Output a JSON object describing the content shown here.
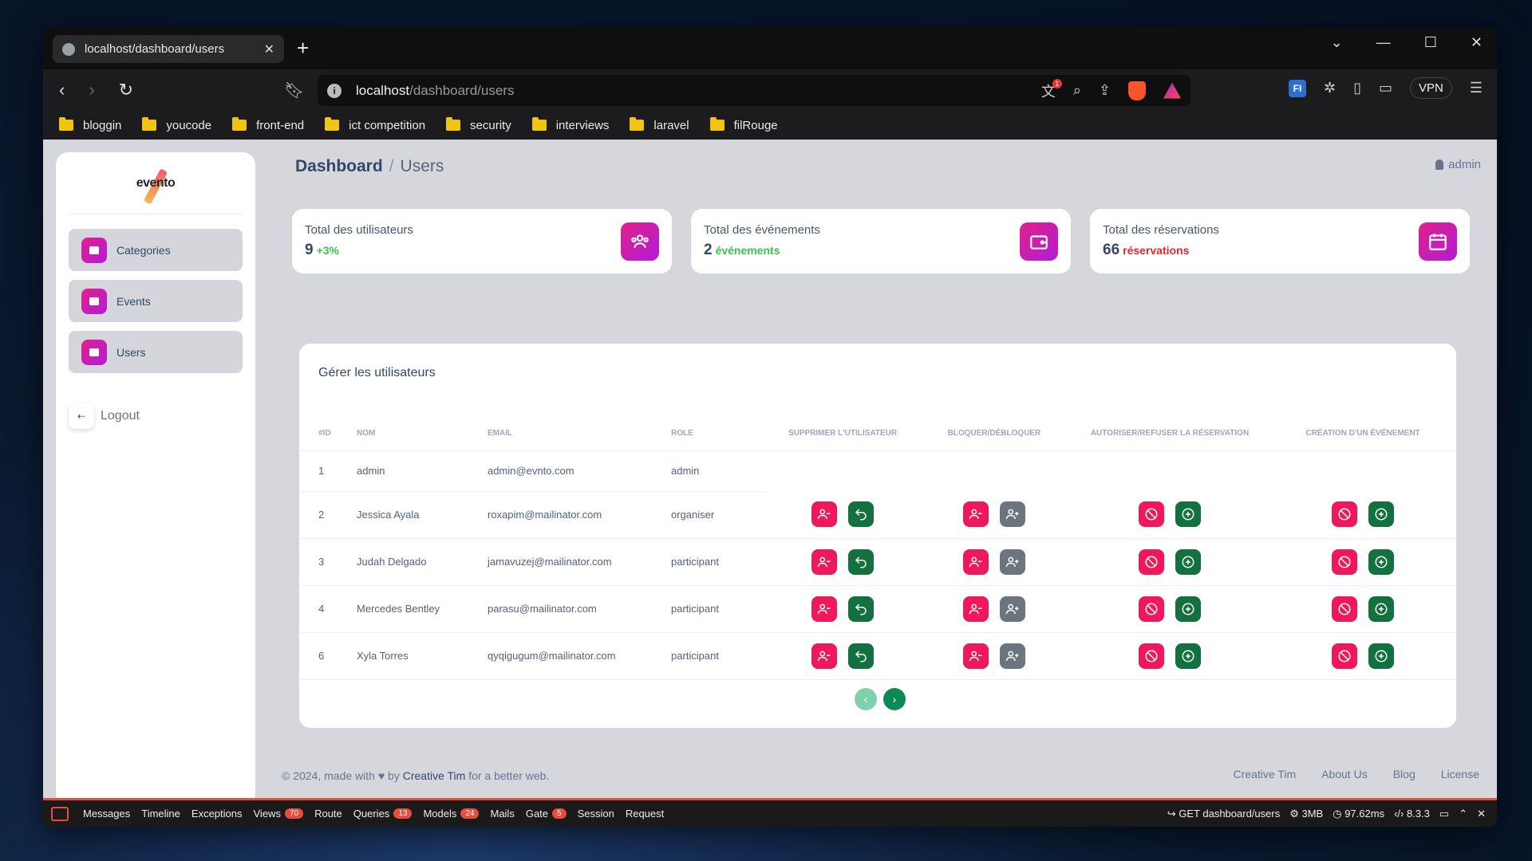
{
  "browser": {
    "tab_title": "localhost/dashboard/users",
    "url_host": "localhost",
    "url_path": "/dashboard/users",
    "vpn_label": "VPN",
    "rewards_count": "1",
    "ext_label": "FI"
  },
  "bookmarks": [
    "bloggin",
    "youcode",
    "front-end",
    "ict competition",
    "security",
    "interviews",
    "laravel",
    "filRouge"
  ],
  "sidebar": {
    "logo": "evento",
    "items": [
      {
        "label": "Categories"
      },
      {
        "label": "Events"
      },
      {
        "label": "Users"
      }
    ],
    "logout": "Logout"
  },
  "header": {
    "breadcrumb_root": "Dashboard",
    "breadcrumb_sep": "/",
    "breadcrumb_current": "Users",
    "user": "admin"
  },
  "stats": [
    {
      "label": "Total des utilisateurs",
      "value": "9",
      "extra": "+3%"
    },
    {
      "label": "Total des événements",
      "value": "2",
      "extra": "événements"
    },
    {
      "label": "Total des réservations",
      "value": "66",
      "extra": "réservations"
    }
  ],
  "table": {
    "title": "Gérer les utilisateurs",
    "headers": [
      "#ID",
      "NOM",
      "EMAIL",
      "ROLE",
      "SUPPRIMER L'UTILISATEUR",
      "BLOQUER/DÉBLOQUER",
      "AUTORISER/REFUSER LA RÉSERVATION",
      "CRÉATION D'UN ÉVÉNEMENT"
    ],
    "rows": [
      {
        "id": "1",
        "name": "admin",
        "email": "admin@evnto.com",
        "role": "admin"
      },
      {
        "id": "2",
        "name": "Jessica Ayala",
        "email": "roxapim@mailinator.com",
        "role": "organiser"
      },
      {
        "id": "3",
        "name": "Judah Delgado",
        "email": "jamavuzej@mailinator.com",
        "role": "participant"
      },
      {
        "id": "4",
        "name": "Mercedes Bentley",
        "email": "parasu@mailinator.com",
        "role": "participant"
      },
      {
        "id": "6",
        "name": "Xyla Torres",
        "email": "qyqigugum@mailinator.com",
        "role": "participant"
      }
    ]
  },
  "footer": {
    "copyright_prefix": "© 2024, made with",
    "by": "by",
    "author": "Creative Tim",
    "suffix": "for a better web.",
    "links": [
      "Creative Tim",
      "About Us",
      "Blog",
      "License"
    ]
  },
  "debugbar": {
    "items": [
      {
        "label": "Messages"
      },
      {
        "label": "Timeline"
      },
      {
        "label": "Exceptions"
      },
      {
        "label": "Views",
        "badge": "70"
      },
      {
        "label": "Route"
      },
      {
        "label": "Queries",
        "badge": "13"
      },
      {
        "label": "Models",
        "badge": "24"
      },
      {
        "label": "Mails"
      },
      {
        "label": "Gate",
        "badge": "5"
      },
      {
        "label": "Session"
      },
      {
        "label": "Request"
      }
    ],
    "request": "GET dashboard/users",
    "memory": "3MB",
    "time": "97.62ms",
    "php": "8.3.3"
  },
  "colors": {
    "accent_gradient_start": "#e0218a",
    "accent_gradient_end": "#b31bd8",
    "danger": "#f0185c",
    "success": "#12713e",
    "secondary": "#6c757d"
  }
}
